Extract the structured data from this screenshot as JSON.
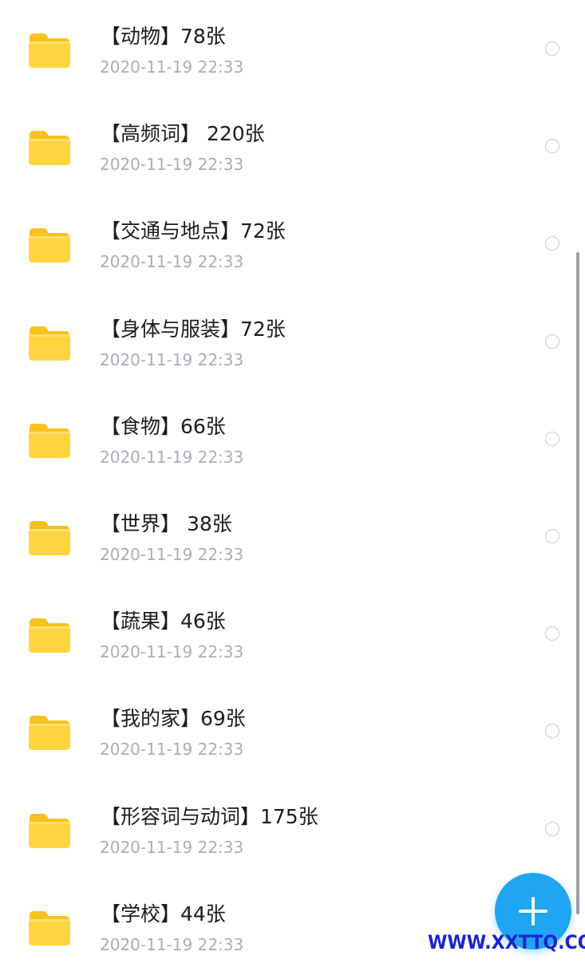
{
  "folders": [
    {
      "name": "【动物】78张",
      "date": "2020-11-19 22:33"
    },
    {
      "name": "【高频词】 220张",
      "date": "2020-11-19 22:33"
    },
    {
      "name": "【交通与地点】72张",
      "date": "2020-11-19 22:33"
    },
    {
      "name": "【身体与服装】72张",
      "date": "2020-11-19 22:33"
    },
    {
      "name": "【食物】66张",
      "date": "2020-11-19 22:33"
    },
    {
      "name": "【世界】 38张",
      "date": "2020-11-19 22:33"
    },
    {
      "name": "【蔬果】46张",
      "date": "2020-11-19 22:33"
    },
    {
      "name": "【我的家】69张",
      "date": "2020-11-19 22:33"
    },
    {
      "name": "【形容词与动词】175张",
      "date": "2020-11-19 22:33"
    },
    {
      "name": "【学校】44张",
      "date": "2020-11-19 22:33"
    }
  ],
  "icons": {
    "folder": "folder-icon",
    "select": "radio-circle",
    "add": "plus-icon"
  },
  "colors": {
    "folder_front": "#FFD43E",
    "folder_back": "#F7C21F",
    "fab": "#1FA5F2",
    "date_text": "#A8AEB8",
    "watermark": "#1A23D6"
  },
  "watermark": "WWW.XXTTQ.COM"
}
